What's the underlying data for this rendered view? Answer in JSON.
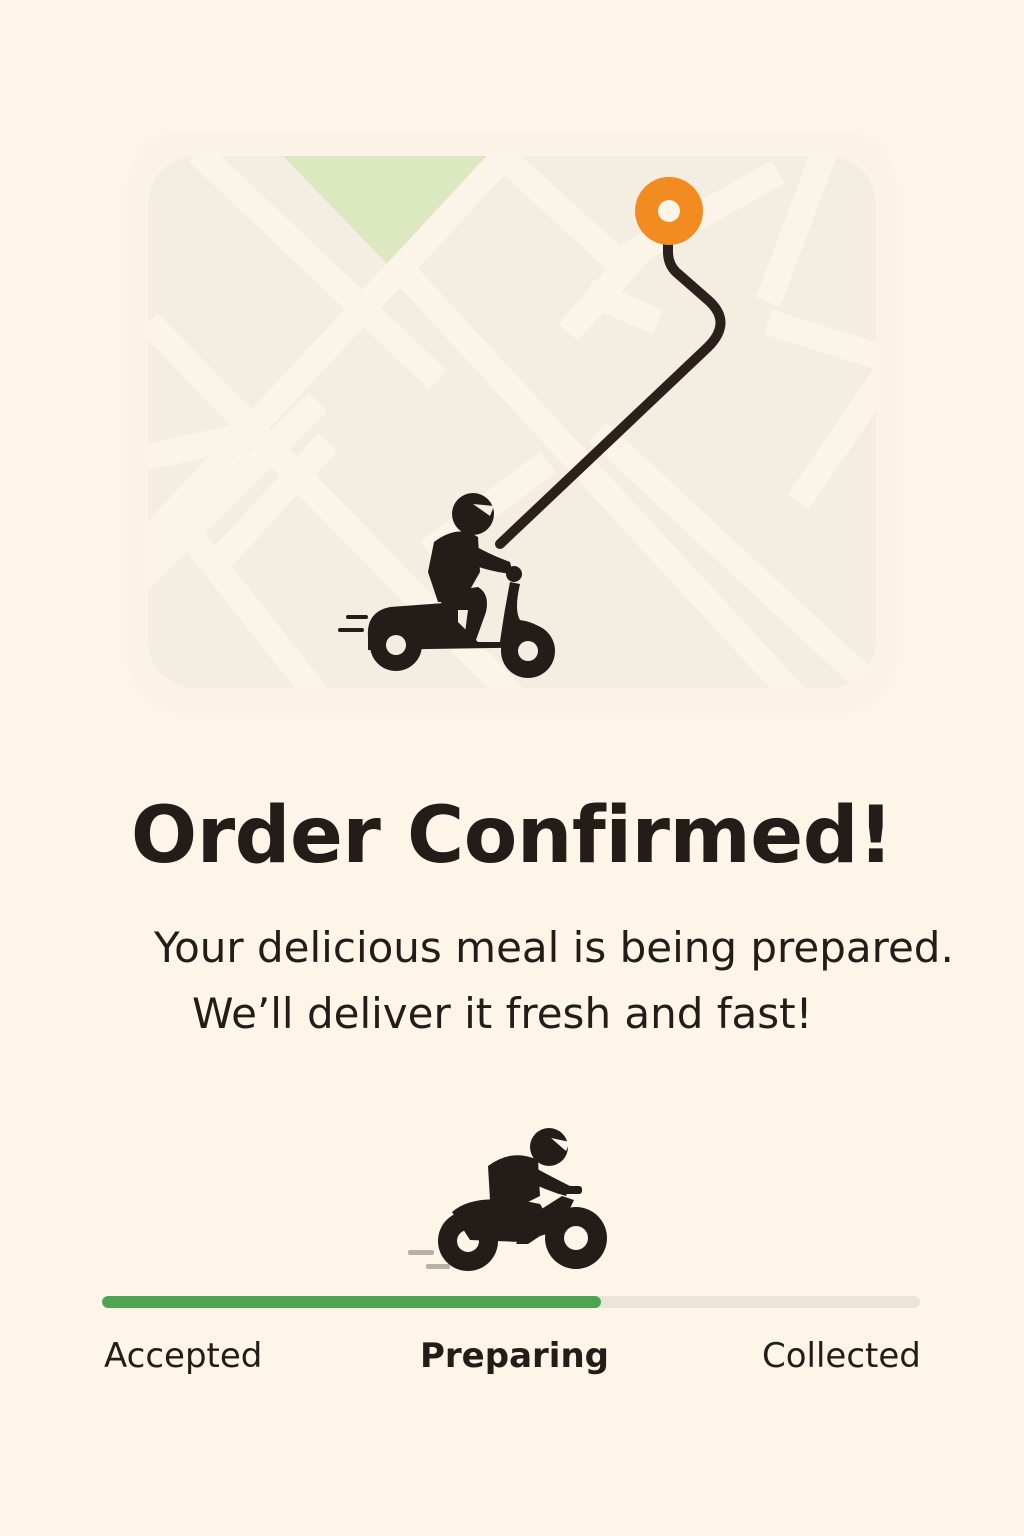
{
  "map": {
    "destination_pin_color": "#f28b20",
    "route_color": "#2b211c",
    "park_color": "#dce8bf",
    "rider_icon": "scooter-rider-icon",
    "pin_icon": "location-pin-icon"
  },
  "confirmation": {
    "title": "Order Confirmed!",
    "subtitle_line1": "Your delicious meal is being prepared.",
    "subtitle_line2": "We’ll deliver it fresh and fast!"
  },
  "progress": {
    "rider_icon": "motorbike-rider-icon",
    "fill_fraction": 0.61,
    "fill_color": "#4ea453",
    "track_color": "#ebe4d8",
    "steps": [
      {
        "label": "Accepted"
      },
      {
        "label": "Preparing",
        "current": true
      },
      {
        "label": "Collected"
      }
    ]
  }
}
